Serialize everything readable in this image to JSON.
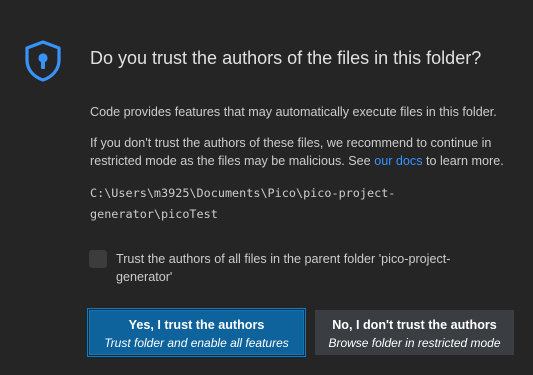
{
  "dialog": {
    "icon": "shield-lock-icon",
    "title": "Do you trust the authors of the files in this folder?",
    "paragraph1": "Code provides features that may automatically execute files in this folder.",
    "paragraph2_before": "If you don't trust the authors of these files, we recommend to continue in restricted mode as the files may be malicious. See ",
    "paragraph2_link": "our docs",
    "paragraph2_after": " to learn more.",
    "folder_path_line1": "C:\\Users\\m3925\\Documents\\Pico\\pico-project-",
    "folder_path_line2": "generator\\picoTest",
    "checkbox_label": "Trust the authors of all files in the parent folder 'pico-project-generator'",
    "checkbox_checked": false
  },
  "buttons": {
    "trust_label": "Yes, I trust the authors",
    "trust_sub": "Trust folder and enable all features",
    "no_trust_label": "No, I don't trust the authors",
    "no_trust_sub": "Browse folder in restricted mode"
  },
  "colors": {
    "background": "#252526",
    "accent": "#3794ff",
    "primary_button": "#0e639c",
    "secondary_button": "#3a3d41"
  }
}
